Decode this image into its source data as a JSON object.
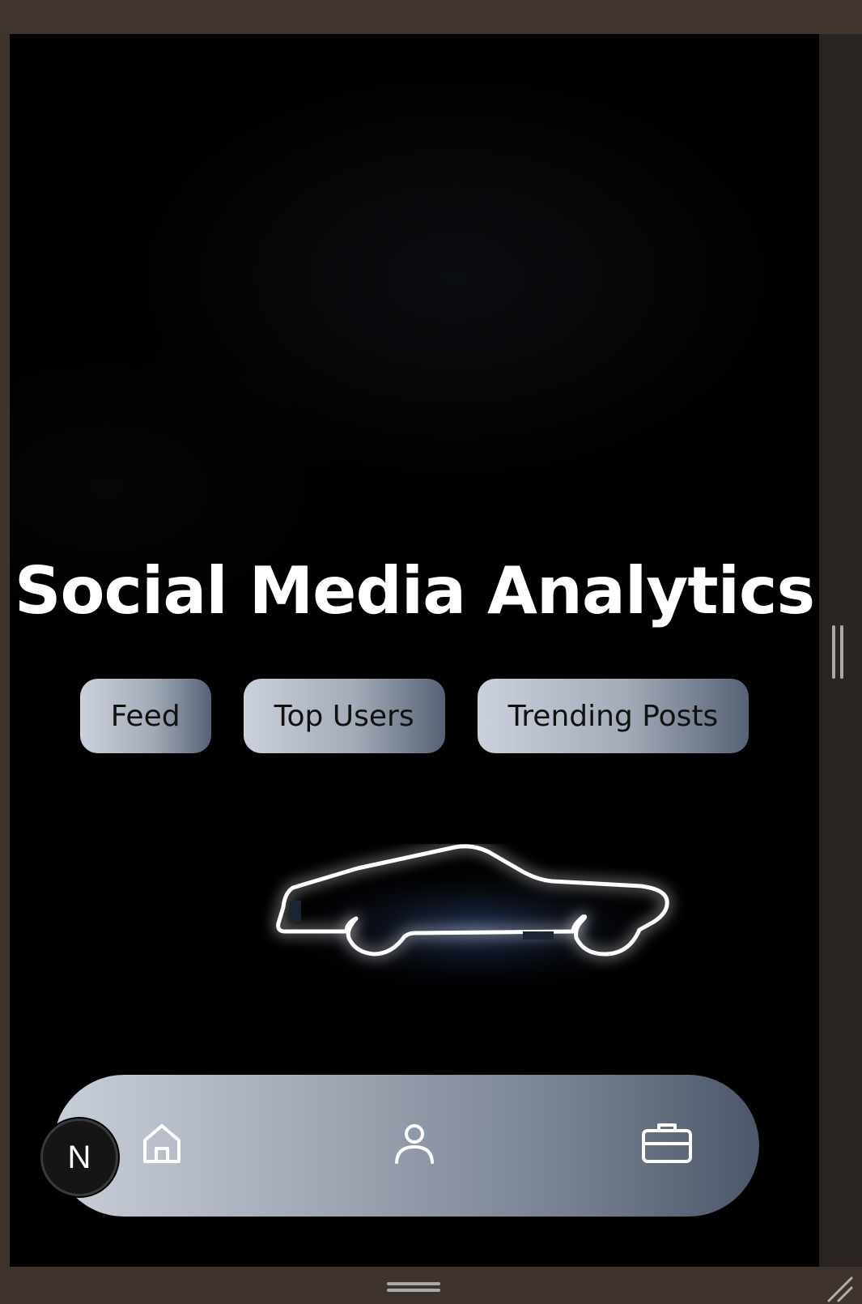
{
  "app": {
    "title": "Social Media Analytics"
  },
  "tabs": [
    {
      "label": "Feed"
    },
    {
      "label": "Top Users"
    },
    {
      "label": "Trending Posts"
    }
  ],
  "bottom_nav": {
    "items": [
      {
        "icon": "home-icon"
      },
      {
        "icon": "user-icon"
      },
      {
        "icon": "briefcase-icon"
      }
    ],
    "badge_letter": "N"
  },
  "colors": {
    "background": "#000000",
    "frame": "#3e332d",
    "title": "#ffffff",
    "tab_gradient_start": "#cbd1dc",
    "tab_gradient_end": "#566274",
    "nav_gradient_start": "#c9cfd9",
    "nav_gradient_end": "#4c586a",
    "neon": "#ffffff"
  }
}
